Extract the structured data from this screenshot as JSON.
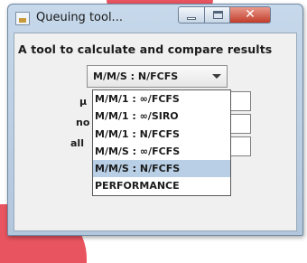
{
  "window": {
    "title": "Queuing tool...",
    "close_glyph": "✕"
  },
  "heading": "A tool to calculate and compare results",
  "combo": {
    "selected": "M/M/S : N/FCFS"
  },
  "fields": [
    {
      "label": "μ"
    },
    {
      "label": "no"
    },
    {
      "label": "all"
    }
  ],
  "dropdown": {
    "items": [
      "M/M/1 : ∞/FCFS",
      "M/M/1 : ∞/SIRO",
      "M/M/1 : N/FCFS",
      "M/M/S : ∞/FCFS",
      "M/M/S : N/FCFS",
      "PERFORMANCE"
    ],
    "selected_index": 4
  },
  "colors": {
    "selection": "#b8cfe5",
    "accent_shape": "#e8545f",
    "close_button": "#c23c2a"
  }
}
